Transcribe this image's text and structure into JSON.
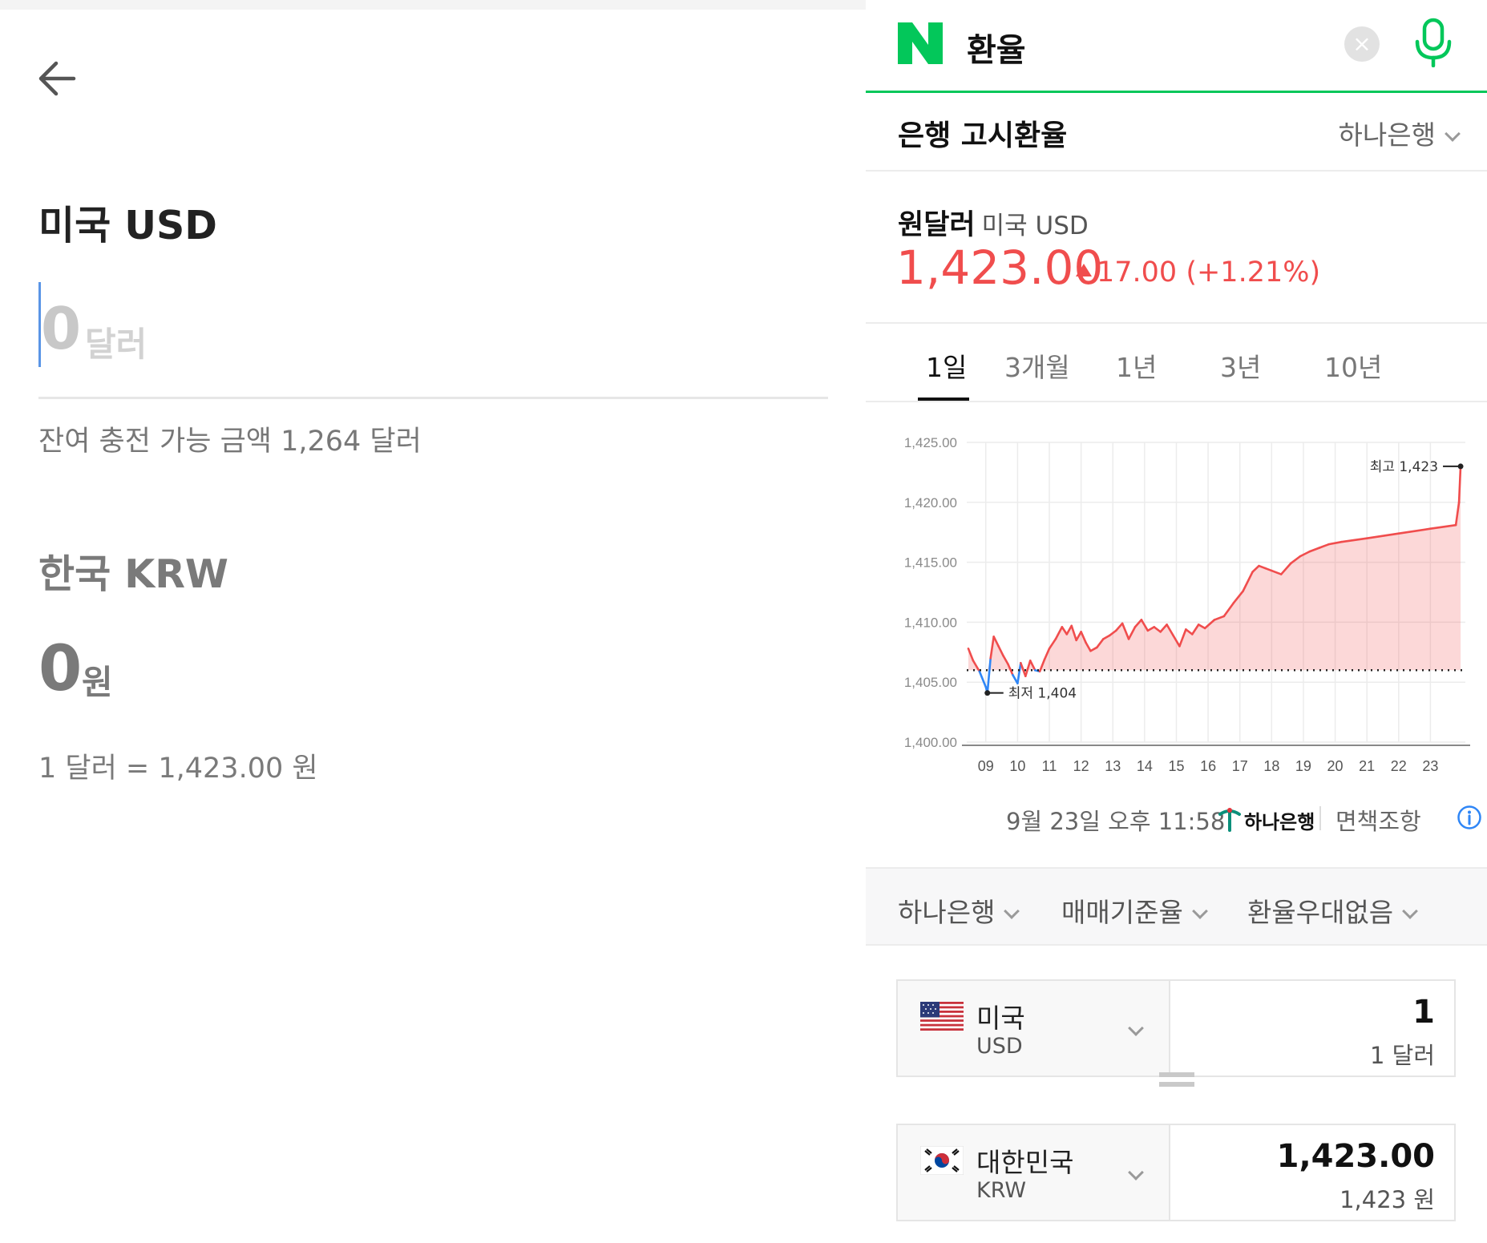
{
  "left": {
    "back_icon": "arrow-left-icon",
    "usd_title": "미국 USD",
    "usd_amount": "0",
    "usd_unit": "달러",
    "remaining_text": "잔여 충전 가능 금액 1,264 달러",
    "krw_title": "한국 KRW",
    "krw_amount": "0",
    "krw_unit": "원",
    "rate_text": "1 달러 = 1,423.00 원"
  },
  "right": {
    "search": {
      "logo": "naver-logo",
      "query": "환율",
      "clear_icon": "close-icon",
      "mic_icon": "microphone-icon"
    },
    "section_title": "은행 고시환율",
    "bank": "하나은행",
    "pair_label": "원달러",
    "pair_sub": "미국 USD",
    "price": "1,423.00",
    "change": "17.00 (+1.21%)",
    "tabs": [
      "1일",
      "3개월",
      "1년",
      "3년",
      "10년"
    ],
    "active_tab": 0,
    "footer": {
      "timestamp": "9월 23일 오후 11:58",
      "source": "하나은행",
      "disclaimer": "면책조항",
      "info_icon": "info-icon"
    },
    "filters": [
      "하나은행",
      "매매기준율",
      "환율우대없음"
    ],
    "converter": [
      {
        "flag": "us-flag-icon",
        "country": "미국",
        "code": "USD",
        "value": "1",
        "value_text": "1 달러"
      },
      {
        "flag": "kr-flag-icon",
        "country": "대한민국",
        "code": "KRW",
        "value": "1,423.00",
        "value_text": "1,423 원"
      }
    ],
    "colors": {
      "up": "#f04d4d",
      "down": "#2f86f6",
      "naver_green": "#03c75a"
    }
  },
  "chart_data": {
    "type": "line",
    "ylim": [
      1400,
      1425
    ],
    "y_ticks": [
      "1,425.00",
      "1,420.00",
      "1,415.00",
      "1,410.00",
      "1,405.00",
      "1,400.00"
    ],
    "y_tick_values": [
      1425,
      1420,
      1415,
      1410,
      1405,
      1400
    ],
    "x_ticks": [
      "09",
      "10",
      "11",
      "12",
      "13",
      "14",
      "15",
      "16",
      "17",
      "18",
      "19",
      "20",
      "21",
      "22",
      "23"
    ],
    "x_range": [
      8.4,
      24.1
    ],
    "baseline": 1406,
    "high_label": "최고 1,423",
    "low_label": "최저 1,404",
    "series": [
      {
        "values": [
          [
            8.45,
            1407.8
          ],
          [
            8.6,
            1406.8
          ],
          [
            8.8,
            1405.9
          ],
          [
            9.0,
            1404.6
          ],
          [
            9.05,
            1404.1
          ],
          [
            9.15,
            1407.0
          ],
          [
            9.25,
            1408.8
          ],
          [
            9.4,
            1408.0
          ],
          [
            9.55,
            1407.2
          ],
          [
            9.7,
            1406.5
          ],
          [
            9.85,
            1405.6
          ],
          [
            10.0,
            1404.9
          ],
          [
            10.1,
            1406.6
          ],
          [
            10.25,
            1405.5
          ],
          [
            10.4,
            1406.8
          ],
          [
            10.55,
            1406.0
          ],
          [
            10.7,
            1405.9
          ],
          [
            10.85,
            1406.9
          ],
          [
            11.0,
            1407.8
          ],
          [
            11.2,
            1408.6
          ],
          [
            11.4,
            1409.6
          ],
          [
            11.55,
            1409.0
          ],
          [
            11.7,
            1409.7
          ],
          [
            11.85,
            1408.5
          ],
          [
            12.0,
            1409.2
          ],
          [
            12.15,
            1408.3
          ],
          [
            12.3,
            1407.6
          ],
          [
            12.5,
            1407.9
          ],
          [
            12.7,
            1408.6
          ],
          [
            12.9,
            1408.9
          ],
          [
            13.1,
            1409.3
          ],
          [
            13.3,
            1409.9
          ],
          [
            13.5,
            1408.6
          ],
          [
            13.7,
            1409.6
          ],
          [
            13.9,
            1410.2
          ],
          [
            14.1,
            1409.3
          ],
          [
            14.3,
            1409.6
          ],
          [
            14.5,
            1409.2
          ],
          [
            14.7,
            1409.8
          ],
          [
            14.9,
            1408.9
          ],
          [
            15.1,
            1408.0
          ],
          [
            15.3,
            1409.4
          ],
          [
            15.5,
            1409.0
          ],
          [
            15.7,
            1409.8
          ],
          [
            15.9,
            1409.5
          ],
          [
            16.2,
            1410.2
          ],
          [
            16.5,
            1410.5
          ],
          [
            16.8,
            1411.6
          ],
          [
            17.1,
            1412.6
          ],
          [
            17.4,
            1414.2
          ],
          [
            17.6,
            1414.7
          ],
          [
            17.8,
            1414.5
          ],
          [
            18.0,
            1414.3
          ],
          [
            18.3,
            1414.0
          ],
          [
            18.6,
            1414.9
          ],
          [
            18.9,
            1415.5
          ],
          [
            19.2,
            1415.9
          ],
          [
            19.5,
            1416.2
          ],
          [
            19.8,
            1416.5
          ],
          [
            20.2,
            1416.7
          ],
          [
            21.0,
            1417.0
          ],
          [
            22.0,
            1417.4
          ],
          [
            23.0,
            1417.8
          ],
          [
            23.8,
            1418.1
          ],
          [
            23.9,
            1420.0
          ],
          [
            23.95,
            1423.0
          ]
        ]
      }
    ]
  }
}
